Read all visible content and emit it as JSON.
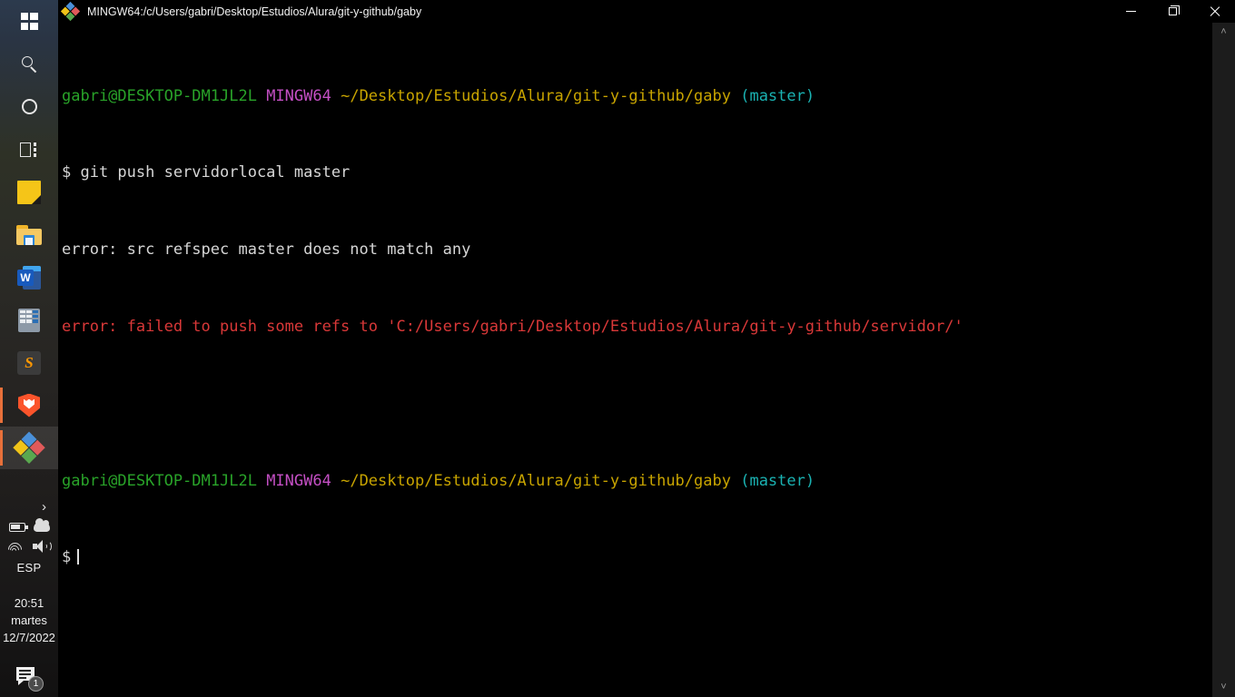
{
  "window": {
    "title": "MINGW64:/c/Users/gabri/Desktop/Estudios/Alura/git-y-github/gaby",
    "app_icon": "git-bash-icon",
    "controls": {
      "minimize": "—",
      "restore": "❐",
      "close": "✕"
    }
  },
  "terminal": {
    "lines": [
      {
        "type": "prompt",
        "user": "gabri@DESKTOP-DM1JL2L",
        "host": "MINGW64",
        "path": "~/Desktop/Estudios/Alura/git-y-github/gaby",
        "branch": "(master)"
      },
      {
        "type": "command",
        "prefix": "$ ",
        "text": "git push servidorlocal master"
      },
      {
        "type": "output",
        "text": "error: src refspec master does not match any"
      },
      {
        "type": "error",
        "text": "error: failed to push some refs to 'C:/Users/gabri/Desktop/Estudios/Alura/git-y-github/servidor/'"
      },
      {
        "type": "blank",
        "text": ""
      },
      {
        "type": "prompt",
        "user": "gabri@DESKTOP-DM1JL2L",
        "host": "MINGW64",
        "path": "~/Desktop/Estudios/Alura/git-y-github/gaby",
        "branch": "(master)"
      },
      {
        "type": "input",
        "prefix": "$",
        "text": ""
      }
    ],
    "colors": {
      "user": "#29a329",
      "host": "#c44fc4",
      "path": "#c8a400",
      "branch": "#1ab2b2",
      "output": "#d6d6d6",
      "error": "#d93838",
      "background": "#000000"
    }
  },
  "scrollbar": {
    "up_arrow": "˄",
    "down_arrow": "˅"
  },
  "taskbar": {
    "items": [
      {
        "name": "start-button",
        "icon": "windows-logo-icon",
        "label": "Start",
        "active": false,
        "running": false
      },
      {
        "name": "search-button",
        "icon": "search-icon",
        "label": "Search",
        "active": false,
        "running": false
      },
      {
        "name": "cortana-button",
        "icon": "circle-icon",
        "label": "Cortana",
        "active": false,
        "running": false
      },
      {
        "name": "task-view-button",
        "icon": "task-view-icon",
        "label": "Task View",
        "active": false,
        "running": false
      },
      {
        "name": "sticky-notes-button",
        "icon": "sticky-note-icon",
        "label": "Sticky Notes",
        "active": false,
        "running": false
      },
      {
        "name": "file-explorer-button",
        "icon": "folder-icon",
        "label": "File Explorer",
        "active": false,
        "running": false
      },
      {
        "name": "word-button",
        "icon": "word-icon",
        "label": "Word",
        "active": false,
        "running": false
      },
      {
        "name": "calculator-button",
        "icon": "calculator-icon",
        "label": "Calculator",
        "active": false,
        "running": false
      },
      {
        "name": "sublime-text-button",
        "icon": "sublime-text-icon",
        "label": "Sublime Text",
        "active": false,
        "running": false
      },
      {
        "name": "brave-button",
        "icon": "brave-shield-icon",
        "label": "Brave",
        "active": false,
        "running": true
      },
      {
        "name": "git-bash-button",
        "icon": "git-bash-icon",
        "label": "Git Bash",
        "active": true,
        "running": true
      }
    ],
    "word_letter": "W",
    "sublime_letter": "S",
    "tray": {
      "chevron": "›",
      "battery_label": "Battery",
      "onedrive_label": "OneDrive",
      "wifi_label": "Wi-Fi",
      "volume_label": "Volume",
      "language": "ESP",
      "time": "20:51",
      "day": "martes",
      "date": "12/7/2022",
      "notification_count": "1"
    },
    "accent_color": "#e8703a"
  }
}
